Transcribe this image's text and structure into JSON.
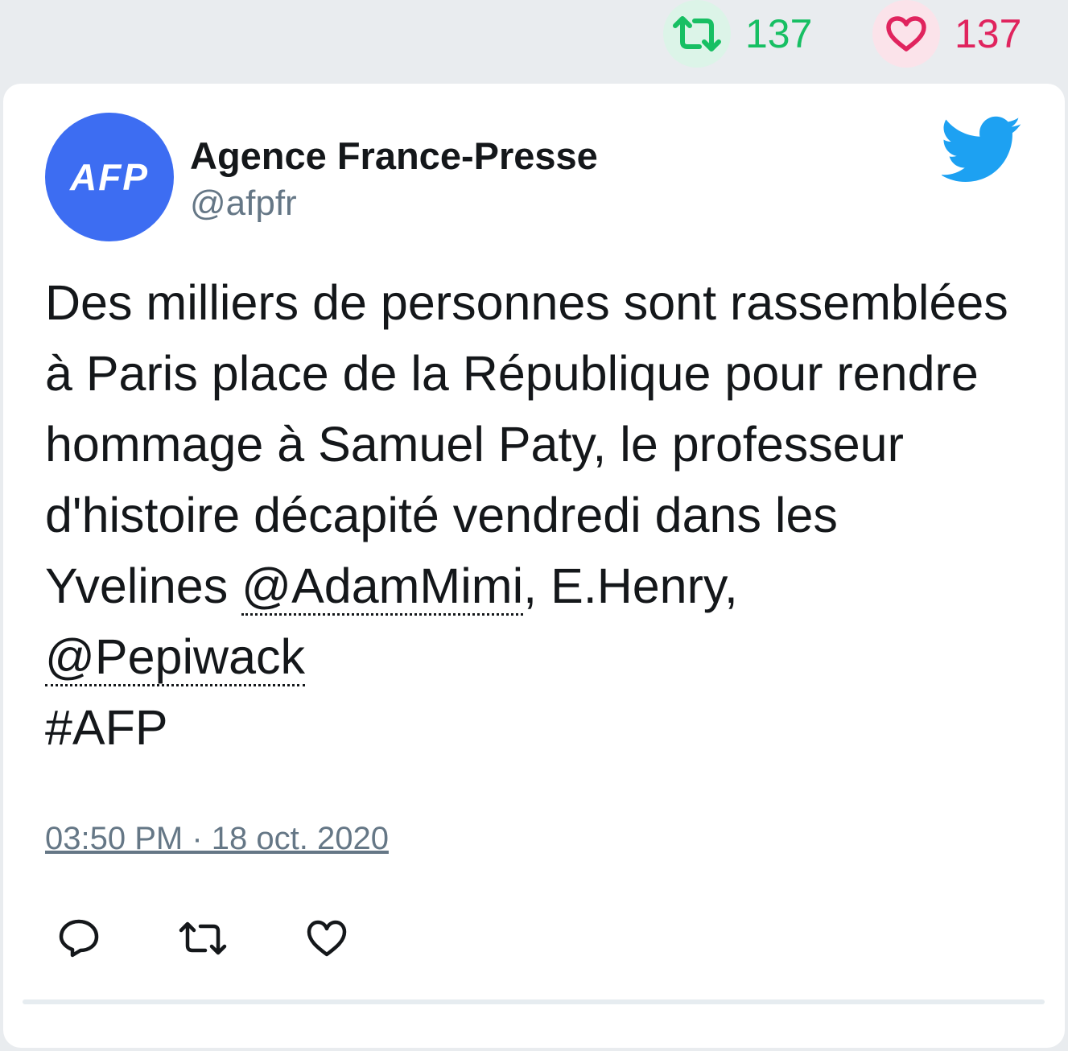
{
  "stats": {
    "retweets": "137",
    "likes": "137",
    "retweet_color": "#17bf63",
    "like_color": "#e0245e"
  },
  "tweet": {
    "author_name": "Agence France-Presse",
    "author_handle": "@afpfr",
    "avatar_text": "AFP",
    "avatar_color": "#3d6df2",
    "text_part1": "Des milliers de personnes sont rassemblées à Paris place de la République pour rendre hommage à Samuel Paty, le professeur d'histoire décapité vendredi dans les Yvelines ",
    "mention1": "@AdamMimi",
    "text_part2": ", E.Henry, ",
    "mention2": "@Pepiwack",
    "hashtag": "#AFP",
    "timestamp": "03:50 PM · 18 oct. 2020"
  },
  "icons": {
    "retweet_stat": "retweet-icon",
    "like_stat": "heart-icon",
    "brand": "twitter-bird-icon",
    "reply": "reply-icon",
    "retweet": "retweet-icon",
    "like": "heart-icon"
  }
}
